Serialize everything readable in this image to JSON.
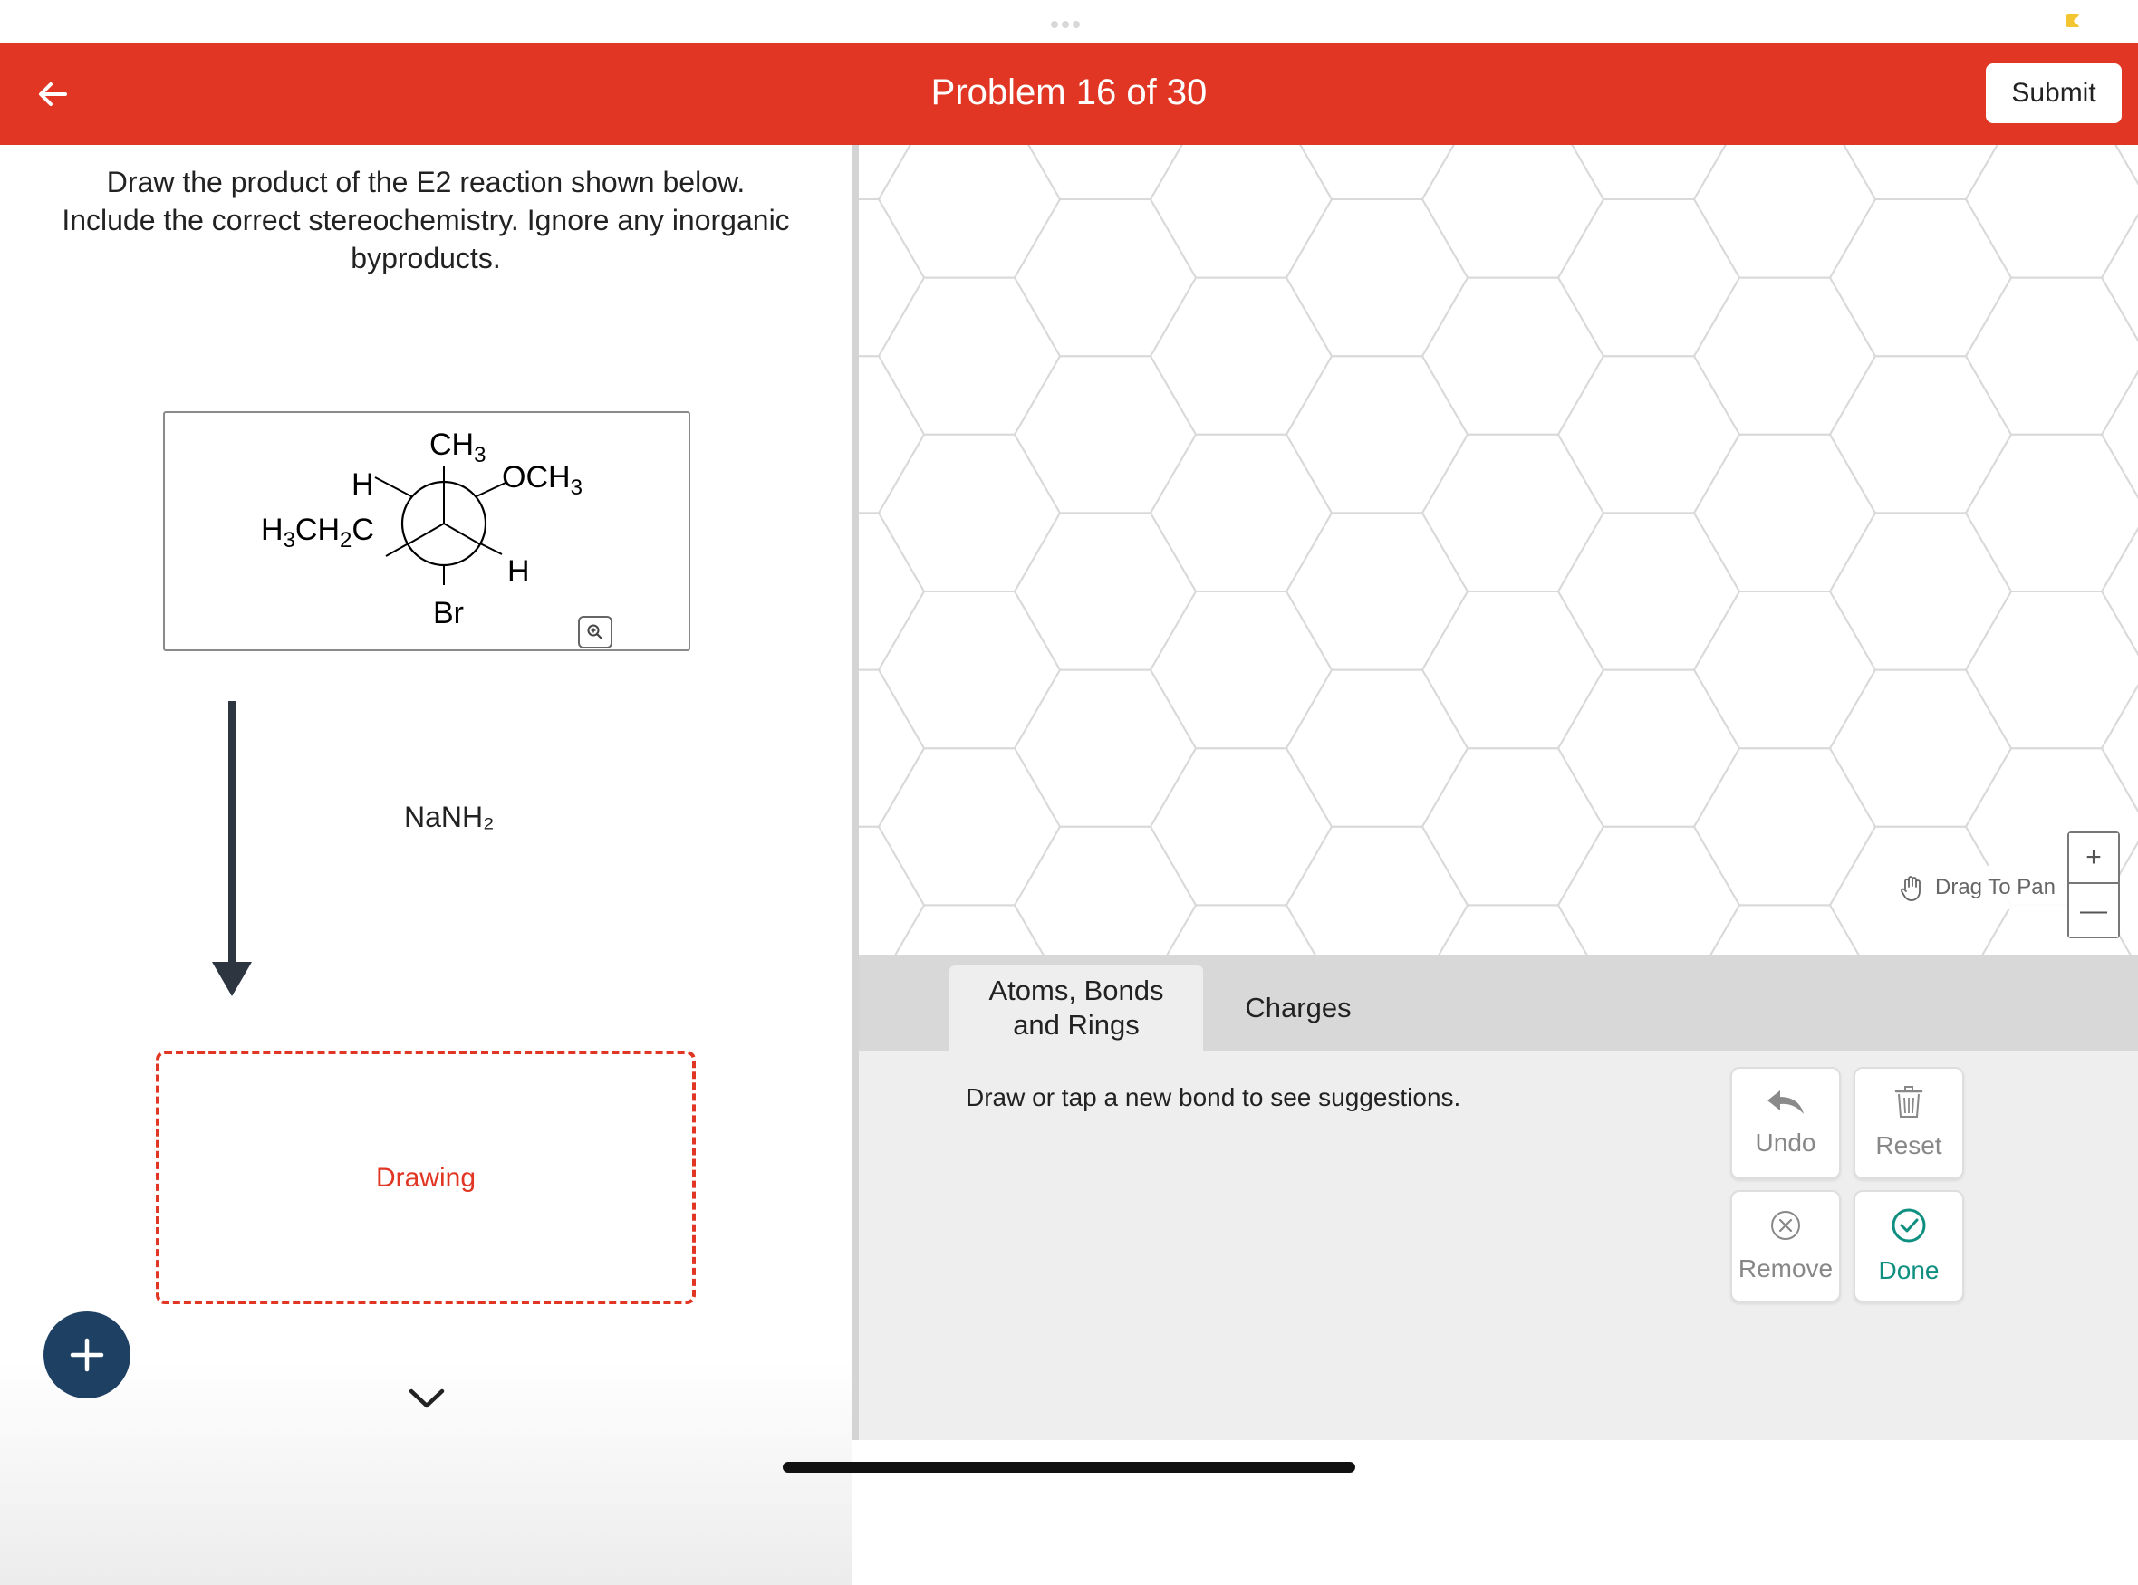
{
  "header": {
    "title": "Problem 16 of 30",
    "submit_label": "Submit",
    "color": "#e03623"
  },
  "question": {
    "line1": "Draw the product of the E2 reaction shown below.",
    "line2": "Include the correct stereochemistry. Ignore any inorganic",
    "line3": "byproducts."
  },
  "molecule": {
    "front_top": "CH",
    "front_top_sub": "3",
    "front_left": "H",
    "front_right": "OCH",
    "front_right_sub": "3",
    "back_left_a": "H",
    "back_left_sub_a": "3",
    "back_left_b": "CH",
    "back_left_sub_b": "2",
    "back_left_c": "C",
    "back_right": "H",
    "back_bottom": "Br"
  },
  "reagent": "NaNH₂",
  "drawing_label": "Drawing",
  "canvas": {
    "pan_hint": "Drag To Pan",
    "zoom_in": "+",
    "zoom_out": "—"
  },
  "tabs": {
    "atoms_line1": "Atoms, Bonds",
    "atoms_line2": "and Rings",
    "charges": "Charges"
  },
  "tools": {
    "hint": "Draw or tap a new bond to see suggestions.",
    "undo": "Undo",
    "reset": "Reset",
    "remove": "Remove",
    "done": "Done",
    "done_color": "#0e8f80"
  },
  "icons": {
    "back": "arrow-left-icon",
    "add": "plus-icon",
    "zoom": "magnify-icon",
    "pan": "hand-icon",
    "undo": "undo-arrow-icon",
    "reset": "trash-icon",
    "remove": "close-circle-icon",
    "done": "check-circle-icon"
  }
}
